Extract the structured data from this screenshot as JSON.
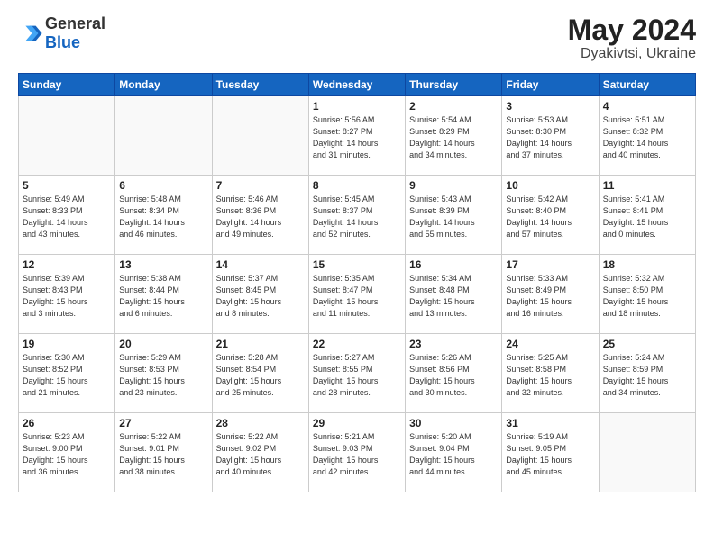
{
  "header": {
    "logo_general": "General",
    "logo_blue": "Blue",
    "month_year": "May 2024",
    "location": "Dyakivtsi, Ukraine"
  },
  "days_of_week": [
    "Sunday",
    "Monday",
    "Tuesday",
    "Wednesday",
    "Thursday",
    "Friday",
    "Saturday"
  ],
  "weeks": [
    [
      {
        "day": "",
        "content": ""
      },
      {
        "day": "",
        "content": ""
      },
      {
        "day": "",
        "content": ""
      },
      {
        "day": "1",
        "content": "Sunrise: 5:56 AM\nSunset: 8:27 PM\nDaylight: 14 hours\nand 31 minutes."
      },
      {
        "day": "2",
        "content": "Sunrise: 5:54 AM\nSunset: 8:29 PM\nDaylight: 14 hours\nand 34 minutes."
      },
      {
        "day": "3",
        "content": "Sunrise: 5:53 AM\nSunset: 8:30 PM\nDaylight: 14 hours\nand 37 minutes."
      },
      {
        "day": "4",
        "content": "Sunrise: 5:51 AM\nSunset: 8:32 PM\nDaylight: 14 hours\nand 40 minutes."
      }
    ],
    [
      {
        "day": "5",
        "content": "Sunrise: 5:49 AM\nSunset: 8:33 PM\nDaylight: 14 hours\nand 43 minutes."
      },
      {
        "day": "6",
        "content": "Sunrise: 5:48 AM\nSunset: 8:34 PM\nDaylight: 14 hours\nand 46 minutes."
      },
      {
        "day": "7",
        "content": "Sunrise: 5:46 AM\nSunset: 8:36 PM\nDaylight: 14 hours\nand 49 minutes."
      },
      {
        "day": "8",
        "content": "Sunrise: 5:45 AM\nSunset: 8:37 PM\nDaylight: 14 hours\nand 52 minutes."
      },
      {
        "day": "9",
        "content": "Sunrise: 5:43 AM\nSunset: 8:39 PM\nDaylight: 14 hours\nand 55 minutes."
      },
      {
        "day": "10",
        "content": "Sunrise: 5:42 AM\nSunset: 8:40 PM\nDaylight: 14 hours\nand 57 minutes."
      },
      {
        "day": "11",
        "content": "Sunrise: 5:41 AM\nSunset: 8:41 PM\nDaylight: 15 hours\nand 0 minutes."
      }
    ],
    [
      {
        "day": "12",
        "content": "Sunrise: 5:39 AM\nSunset: 8:43 PM\nDaylight: 15 hours\nand 3 minutes."
      },
      {
        "day": "13",
        "content": "Sunrise: 5:38 AM\nSunset: 8:44 PM\nDaylight: 15 hours\nand 6 minutes."
      },
      {
        "day": "14",
        "content": "Sunrise: 5:37 AM\nSunset: 8:45 PM\nDaylight: 15 hours\nand 8 minutes."
      },
      {
        "day": "15",
        "content": "Sunrise: 5:35 AM\nSunset: 8:47 PM\nDaylight: 15 hours\nand 11 minutes."
      },
      {
        "day": "16",
        "content": "Sunrise: 5:34 AM\nSunset: 8:48 PM\nDaylight: 15 hours\nand 13 minutes."
      },
      {
        "day": "17",
        "content": "Sunrise: 5:33 AM\nSunset: 8:49 PM\nDaylight: 15 hours\nand 16 minutes."
      },
      {
        "day": "18",
        "content": "Sunrise: 5:32 AM\nSunset: 8:50 PM\nDaylight: 15 hours\nand 18 minutes."
      }
    ],
    [
      {
        "day": "19",
        "content": "Sunrise: 5:30 AM\nSunset: 8:52 PM\nDaylight: 15 hours\nand 21 minutes."
      },
      {
        "day": "20",
        "content": "Sunrise: 5:29 AM\nSunset: 8:53 PM\nDaylight: 15 hours\nand 23 minutes."
      },
      {
        "day": "21",
        "content": "Sunrise: 5:28 AM\nSunset: 8:54 PM\nDaylight: 15 hours\nand 25 minutes."
      },
      {
        "day": "22",
        "content": "Sunrise: 5:27 AM\nSunset: 8:55 PM\nDaylight: 15 hours\nand 28 minutes."
      },
      {
        "day": "23",
        "content": "Sunrise: 5:26 AM\nSunset: 8:56 PM\nDaylight: 15 hours\nand 30 minutes."
      },
      {
        "day": "24",
        "content": "Sunrise: 5:25 AM\nSunset: 8:58 PM\nDaylight: 15 hours\nand 32 minutes."
      },
      {
        "day": "25",
        "content": "Sunrise: 5:24 AM\nSunset: 8:59 PM\nDaylight: 15 hours\nand 34 minutes."
      }
    ],
    [
      {
        "day": "26",
        "content": "Sunrise: 5:23 AM\nSunset: 9:00 PM\nDaylight: 15 hours\nand 36 minutes."
      },
      {
        "day": "27",
        "content": "Sunrise: 5:22 AM\nSunset: 9:01 PM\nDaylight: 15 hours\nand 38 minutes."
      },
      {
        "day": "28",
        "content": "Sunrise: 5:22 AM\nSunset: 9:02 PM\nDaylight: 15 hours\nand 40 minutes."
      },
      {
        "day": "29",
        "content": "Sunrise: 5:21 AM\nSunset: 9:03 PM\nDaylight: 15 hours\nand 42 minutes."
      },
      {
        "day": "30",
        "content": "Sunrise: 5:20 AM\nSunset: 9:04 PM\nDaylight: 15 hours\nand 44 minutes."
      },
      {
        "day": "31",
        "content": "Sunrise: 5:19 AM\nSunset: 9:05 PM\nDaylight: 15 hours\nand 45 minutes."
      },
      {
        "day": "",
        "content": ""
      }
    ]
  ]
}
